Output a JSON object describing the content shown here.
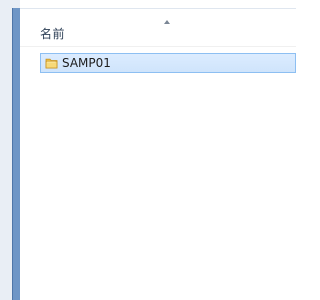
{
  "column_header": {
    "name_label": "名前",
    "sort_direction": "ascending",
    "sort_icon": "sort-up-icon"
  },
  "files": [
    {
      "name": "SAMP01",
      "icon": "folder-icon",
      "selected": true
    }
  ],
  "colors": {
    "selection_fill": "#cfe4fb",
    "selection_border": "#8dbff2",
    "window_accent": "#6f96c6"
  }
}
